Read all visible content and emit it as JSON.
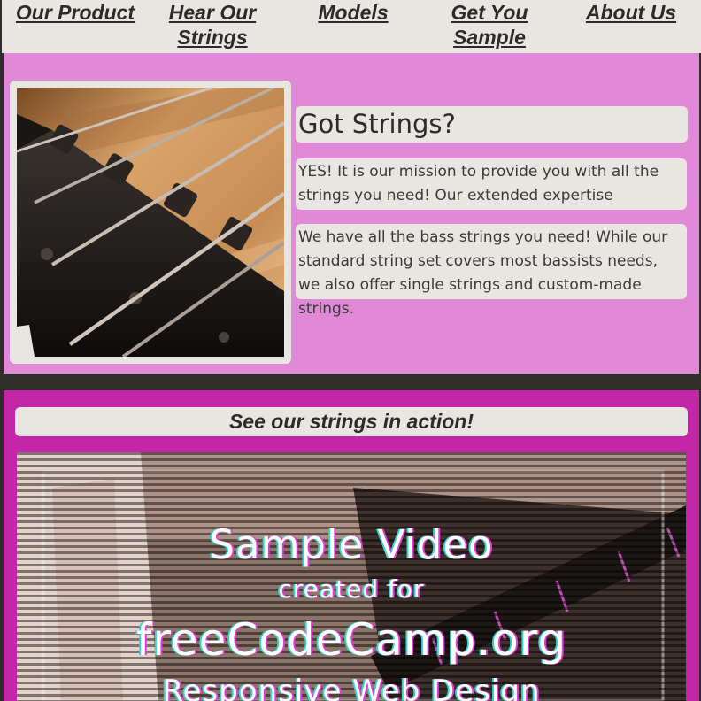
{
  "nav": {
    "items": [
      {
        "label": "Our Product"
      },
      {
        "label": "Hear Our Strings"
      },
      {
        "label": "Models"
      },
      {
        "label": "Get You Sample"
      },
      {
        "label": "About Us"
      }
    ]
  },
  "hero": {
    "title": "Got Strings?",
    "paragraph_1": "YES! It is our mission to provide you with all the strings you need! Our extended expertise",
    "paragraph_2": "We have all the bass strings you need! While our standard string set covers most bassists needs, we also offer single strings and custom-made strings."
  },
  "video_section": {
    "heading": "See our strings in action!",
    "video_lines": [
      "Sample Video",
      "created for",
      "freeCodeCamp.org",
      "Responsive Web Design"
    ]
  },
  "colors": {
    "nav_bg": "#e9e6e1",
    "hero_bg": "#df89d7",
    "video_section_bg": "#c327a7",
    "page_bg": "#2f2c2c"
  }
}
